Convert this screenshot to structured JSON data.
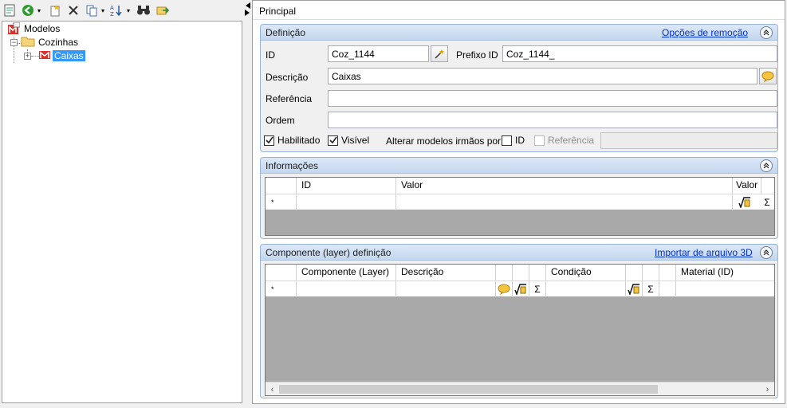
{
  "toolbar": {
    "icons": [
      "properties-icon",
      "back-icon",
      "new-icon",
      "delete-icon",
      "copy-icon",
      "sort-icon",
      "find-icon",
      "export-icon"
    ]
  },
  "tree": {
    "root": "Modelos",
    "child": "Cozinhas",
    "grandchild": "Caixas"
  },
  "tab": {
    "label": "Principal"
  },
  "definicao": {
    "title": "Definição",
    "link": "Opções de remoção",
    "id_label": "ID",
    "id_value": "Coz_1144",
    "prefix_label": "Prefixo ID",
    "prefix_value": "Coz_1144_",
    "desc_label": "Descrição",
    "desc_value": "Caixas",
    "ref_label": "Referência",
    "ref_value": "",
    "order_label": "Ordem",
    "order_value": "",
    "habilitado": "Habilitado",
    "visivel": "Visível",
    "alterar_label": "Alterar modelos irmãos por:",
    "alt_id": "ID",
    "alt_ref": "Referência"
  },
  "informacoes": {
    "title": "Informações",
    "columns": [
      "ID",
      "Valor",
      "Valor"
    ],
    "new_row_marker": "*"
  },
  "componente": {
    "title": "Componente (layer) definição",
    "link": "Importar de arquivo 3D",
    "columns": [
      "Componente (Layer)",
      "Descrição",
      "Condição",
      "Material (ID)"
    ],
    "new_row_marker": "*"
  },
  "colors": {
    "accent": "#3399ff",
    "link": "#0033cc",
    "group_border": "#98b4d8"
  }
}
